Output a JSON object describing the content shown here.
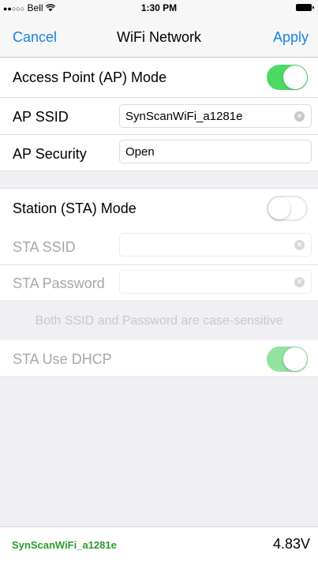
{
  "status_bar": {
    "dots": "●●○○○",
    "carrier": "Bell",
    "wifi_icon": "wifi-icon",
    "time": "1:30 PM",
    "battery_icon": "battery-full-icon"
  },
  "nav": {
    "cancel": "Cancel",
    "title": "WiFi Network",
    "apply": "Apply"
  },
  "ap": {
    "mode_label": "Access Point (AP) Mode",
    "mode_enabled": true,
    "ssid_label": "AP SSID",
    "ssid_value": "SynScanWiFi_a1281e",
    "security_label": "AP Security",
    "security_value": "Open"
  },
  "sta": {
    "mode_label": "Station (STA) Mode",
    "mode_enabled": false,
    "ssid_label": "STA SSID",
    "ssid_value": "",
    "password_label": "STA Password",
    "password_value": "",
    "note": "Both SSID and Password are case-sensitive",
    "dhcp_label": "STA Use DHCP",
    "dhcp_enabled": true
  },
  "footer": {
    "ssid": "SynScanWiFi_a1281e",
    "voltage": "4.83V"
  },
  "colors": {
    "accent": "#1583e8",
    "toggle_on": "#4cd964",
    "footer_ssid": "#2c9a2c"
  }
}
